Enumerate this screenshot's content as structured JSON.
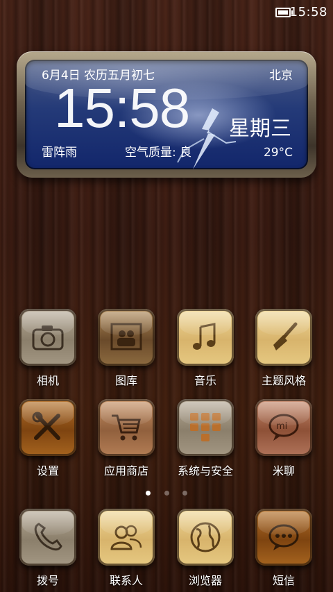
{
  "status_bar": {
    "time": "15:58",
    "battery_icon": "battery-icon"
  },
  "widget": {
    "date": "6月4日 农历五月初七",
    "city": "北京",
    "clock": "15:58",
    "weekday": "星期三",
    "condition": "雷阵雨",
    "air_quality": "空气质量: 良",
    "temperature": "29°C"
  },
  "apps": {
    "camera": {
      "label": "相机",
      "icon": "camera-icon"
    },
    "gallery": {
      "label": "图库",
      "icon": "gallery-icon"
    },
    "music": {
      "label": "音乐",
      "icon": "music-note-icon"
    },
    "themes": {
      "label": "主题风格",
      "icon": "paintbrush-icon"
    },
    "settings": {
      "label": "设置",
      "icon": "tools-icon"
    },
    "app_store": {
      "label": "应用商店",
      "icon": "shopping-cart-icon"
    },
    "security": {
      "label": "系统与安全",
      "icon": "grid-apps-icon"
    },
    "mitalk": {
      "label": "米聊",
      "icon": "chat-bubble-icon"
    }
  },
  "page_indicator": {
    "count": 3,
    "active": 1
  },
  "dock": {
    "dialer": {
      "label": "拨号",
      "icon": "phone-icon"
    },
    "contacts": {
      "label": "联系人",
      "icon": "contacts-icon"
    },
    "browser": {
      "label": "浏览器",
      "icon": "globe-icon"
    },
    "messages": {
      "label": "短信",
      "icon": "message-icon"
    }
  }
}
